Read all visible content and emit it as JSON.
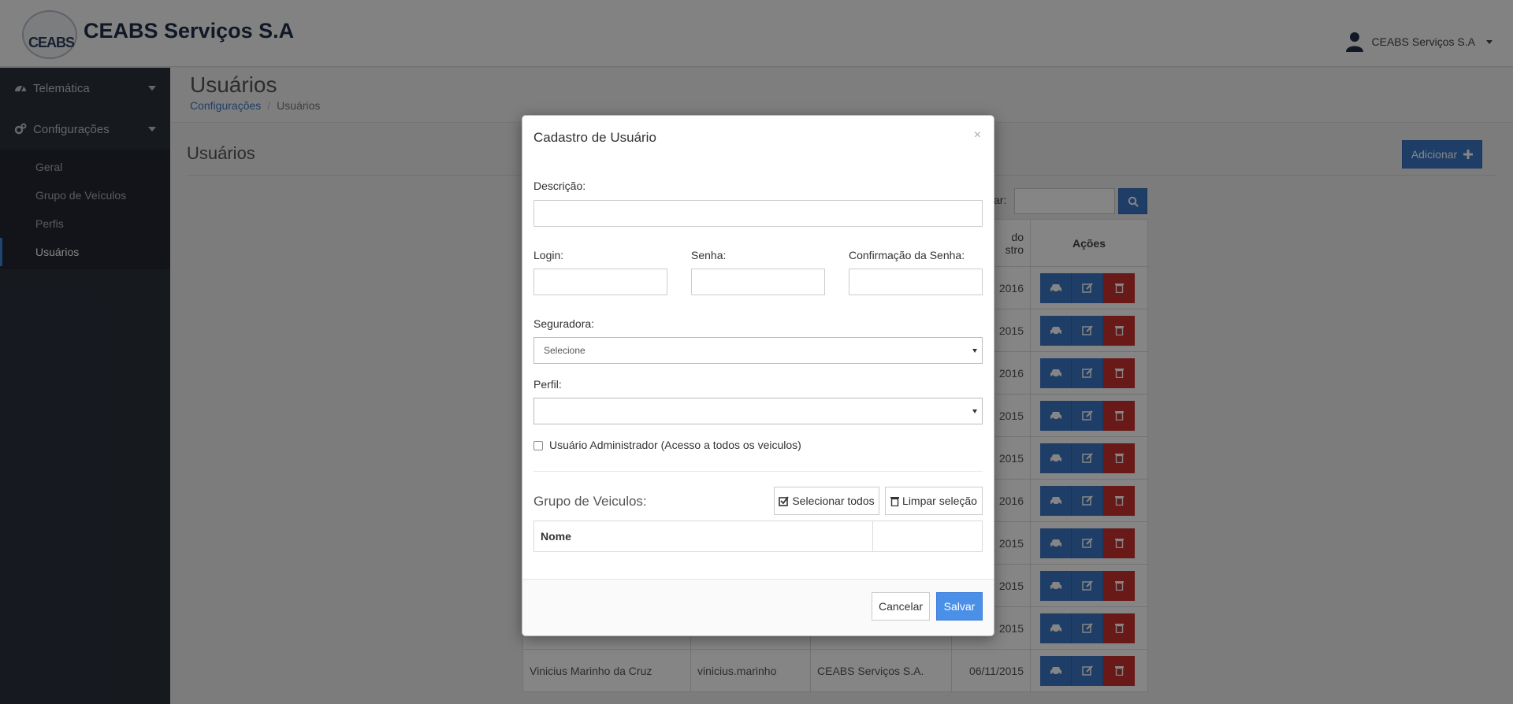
{
  "header": {
    "logo_text": "CEABS",
    "brand": "CEABS Serviços S.A",
    "user_name": "CEABS Serviços S.A"
  },
  "sidebar": {
    "sections": [
      {
        "label": "Telemática"
      },
      {
        "label": "Configurações"
      }
    ],
    "items": [
      {
        "label": "Geral"
      },
      {
        "label": "Grupo de Veículos"
      },
      {
        "label": "Perfis"
      },
      {
        "label": "Usuários"
      }
    ]
  },
  "page": {
    "title": "Usuários",
    "breadcrumb": [
      "Configurações",
      "Usuários"
    ],
    "section_title": "Usuários",
    "add_label": "Adicionar",
    "search_label": "ar:"
  },
  "table": {
    "date_header": "do\nstro",
    "actions_header": "Ações",
    "rows": [
      {
        "name": "",
        "login": "",
        "company": "",
        "date": "2016"
      },
      {
        "name": "",
        "login": "",
        "company": "",
        "date": "2015"
      },
      {
        "name": "",
        "login": "",
        "company": "",
        "date": "2016"
      },
      {
        "name": "",
        "login": "",
        "company": "",
        "date": "2015"
      },
      {
        "name": "",
        "login": "",
        "company": "",
        "date": "2015"
      },
      {
        "name": "",
        "login": "",
        "company": "",
        "date": "2016"
      },
      {
        "name": "",
        "login": "",
        "company": "",
        "date": "2015"
      },
      {
        "name": "",
        "login": "",
        "company": "",
        "date": "2015"
      },
      {
        "name": "",
        "login": "",
        "company": "",
        "date": "2015"
      },
      {
        "name": "Vinicius Marinho da Cruz",
        "login": "vinicius.marinho",
        "company": "CEABS Serviços S.A.",
        "date": "06/11/2015"
      }
    ]
  },
  "modal": {
    "title": "Cadastro de Usuário",
    "close": "×",
    "descricao_label": "Descrição:",
    "login_label": "Login:",
    "senha_label": "Senha:",
    "confirmacao_label": "Confirmação da Senha:",
    "seguradora_label": "Seguradora:",
    "seguradora_value": "Selecione",
    "perfil_label": "Perfil:",
    "perfil_value": "",
    "admin_label": "Usuário Administrador (Acesso a todos os veiculos)",
    "grupo_title": "Grupo de Veiculos:",
    "select_all": "Selecionar todos",
    "clear_selection": "Limpar seleção",
    "col_nome": "Nome",
    "cancel": "Cancelar",
    "save": "Salvar"
  },
  "colors": {
    "primary": "#3a78c8",
    "danger": "#c9302c",
    "sidebar": "#2b303b",
    "save": "#4a90e8"
  }
}
